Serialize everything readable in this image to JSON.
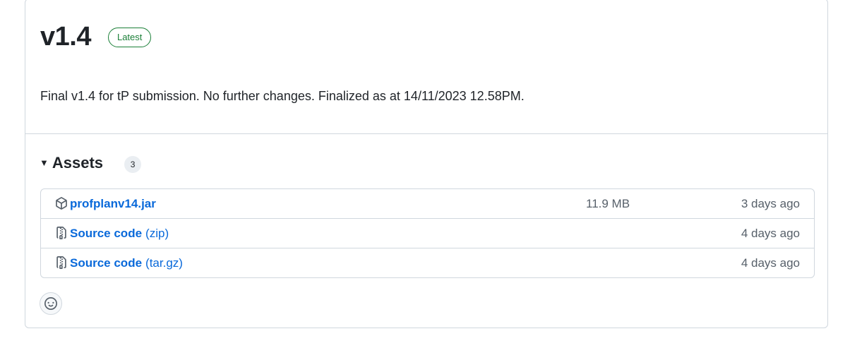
{
  "release": {
    "version": "v1.4",
    "badge": "Latest",
    "description": "Final v1.4 for tP submission. No further changes. Finalized as at 14/11/2023 12.58PM."
  },
  "assets": {
    "title": "Assets",
    "count": "3",
    "items": [
      {
        "name": "profplanv14.jar",
        "suffix": "",
        "size": "11.9 MB",
        "date": "3 days ago",
        "icon": "package-icon"
      },
      {
        "name": "Source code",
        "suffix": "(zip)",
        "size": "",
        "date": "4 days ago",
        "icon": "file-zip-icon"
      },
      {
        "name": "Source code",
        "suffix": "(tar.gz)",
        "size": "",
        "date": "4 days ago",
        "icon": "file-zip-icon"
      }
    ]
  },
  "reactions": {
    "icon": "smiley-icon"
  },
  "colors": {
    "link": "#0969da",
    "badge": "#1a7f37",
    "border": "#d0d7de",
    "muted": "#57606a"
  }
}
